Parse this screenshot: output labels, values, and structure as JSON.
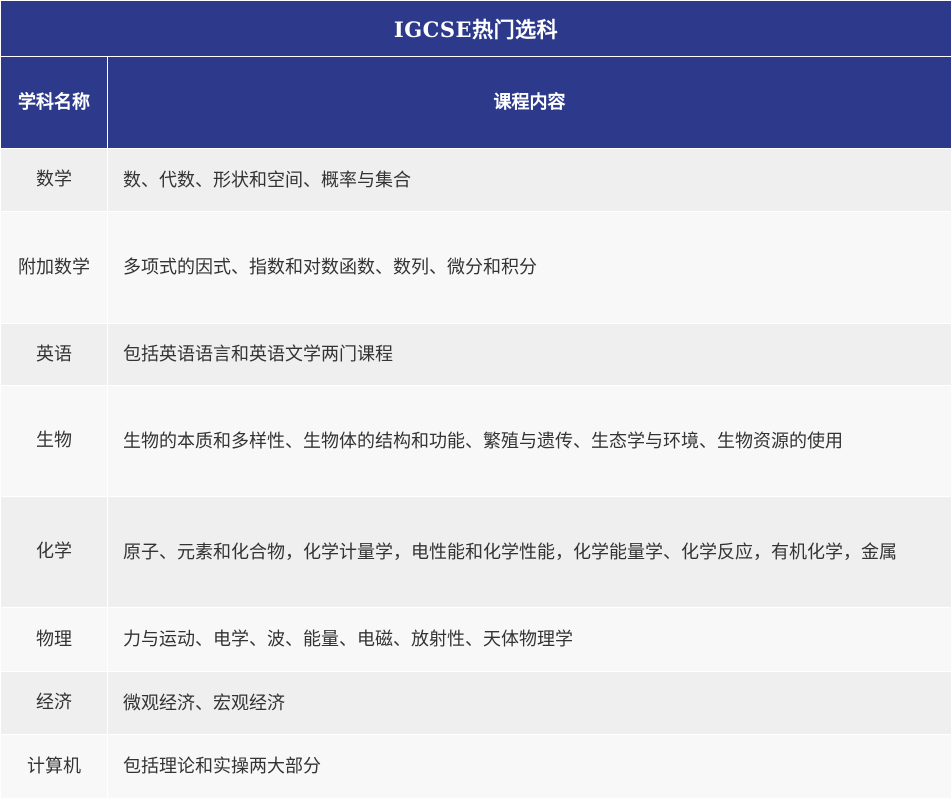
{
  "table": {
    "title": "IGCSE热门选科",
    "header": {
      "subject": "学科名称",
      "content": "课程内容"
    },
    "rows": [
      {
        "subject": "数学",
        "content": "数、代数、形状和空间、概率与集合"
      },
      {
        "subject": "附加数学",
        "content": "多项式的因式、指数和对数函数、数列、微分和积分"
      },
      {
        "subject": "英语",
        "content": "包括英语语言和英语文学两门课程"
      },
      {
        "subject": "生物",
        "content": "生物的本质和多样性、生物体的结构和功能、繁殖与遗传、生态学与环境、生物资源的使用"
      },
      {
        "subject": "化学",
        "content": "原子、元素和化合物，化学计量学，电性能和化学性能，化学能量学、化学反应，有机化学，金属"
      },
      {
        "subject": "物理",
        "content": "力与运动、电学、波、能量、电磁、放射性、天体物理学"
      },
      {
        "subject": "经济",
        "content": "微观经济、宏观经济"
      },
      {
        "subject": "计算机",
        "content": "包括理论和实操两大部分"
      }
    ]
  },
  "colors": {
    "header_bg": "#2d3a8c",
    "header_text": "#ffffff",
    "row_odd_bg": "#efefef",
    "row_even_bg": "#f8f8f8",
    "body_text": "#333333"
  }
}
